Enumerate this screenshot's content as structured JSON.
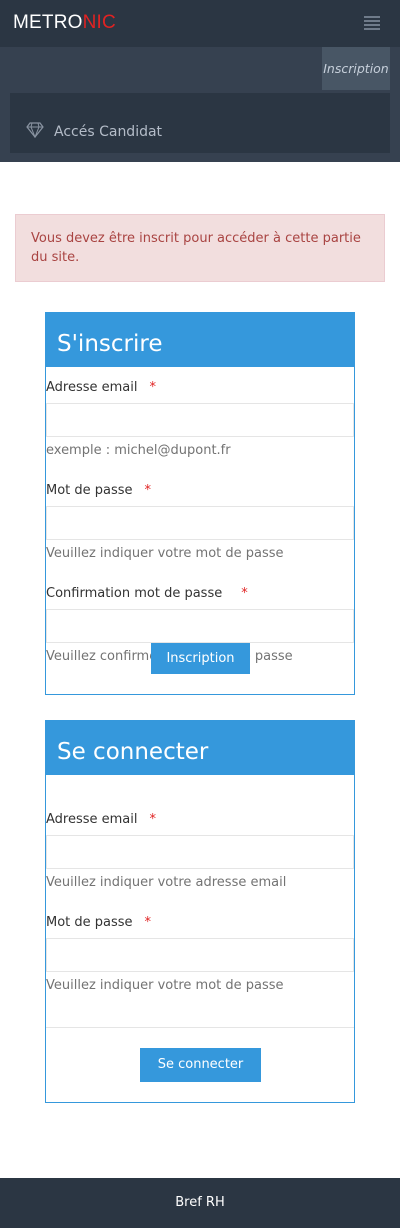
{
  "header": {
    "logo_primary": "METRO",
    "logo_accent": "NIC",
    "menu_icon": "hamburger-icon",
    "nav_inscription": "Inscription"
  },
  "sidebar": {
    "item_icon": "diamond-icon",
    "item_label": "Accés Candidat"
  },
  "alert": {
    "text": "Vous devez être inscrit pour accéder à cette partie du site."
  },
  "register": {
    "title": "S'inscrire",
    "email_label": "Adresse email",
    "email_help": "exemple : michel@dupont.fr",
    "password_label": "Mot de passe",
    "password_help": "Veuillez indiquer votre mot de passe",
    "confirm_label": "Confirmation mot de passe",
    "confirm_help": "Veuillez confirmer votre mot de passe",
    "submit_label": "Inscription",
    "required_mark": "*"
  },
  "login": {
    "title": "Se connecter",
    "email_label": "Adresse email",
    "email_help": "Veuillez indiquer votre adresse email",
    "password_label": "Mot de passe",
    "password_help": "Veuillez indiquer votre mot de passe",
    "submit_label": "Se connecter",
    "required_mark": "*"
  },
  "footer": {
    "text": "Bref RH"
  },
  "colors": {
    "header_bg": "#2b3643",
    "nav_bg": "#364150",
    "accent_blue": "#3598dc",
    "logo_red": "#e02222",
    "alert_bg": "#f2dede",
    "alert_text": "#a94442"
  }
}
